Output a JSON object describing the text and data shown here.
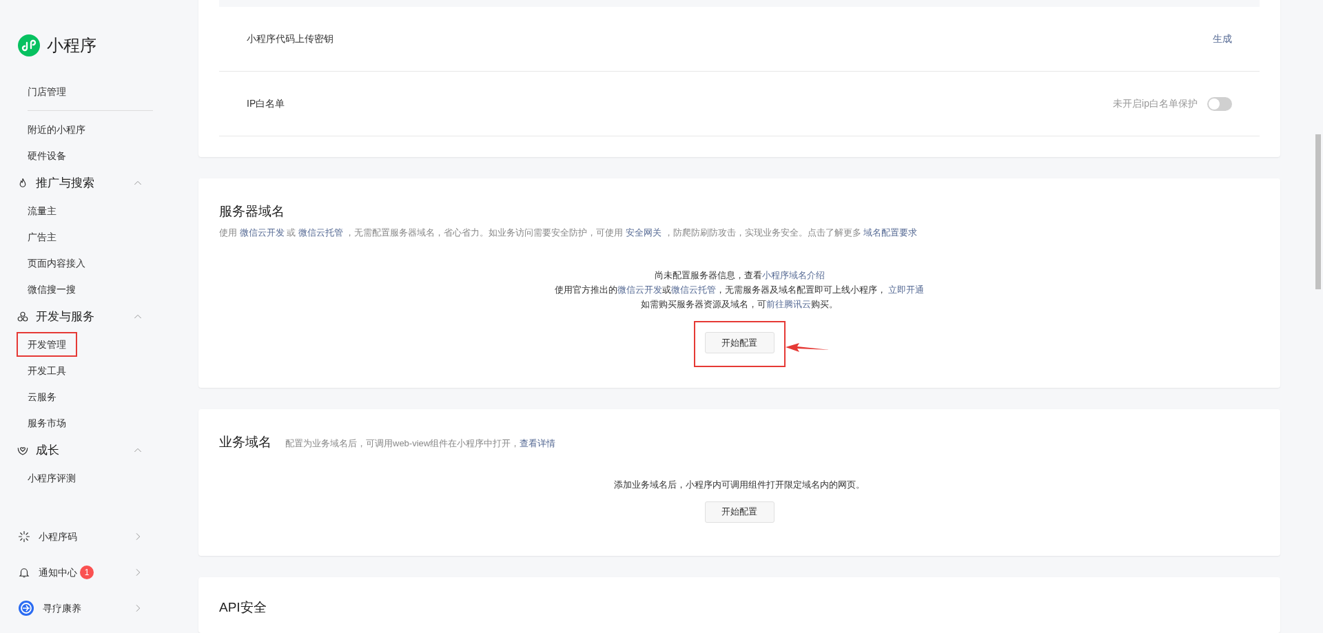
{
  "app": {
    "title": "小程序"
  },
  "sidebar": {
    "groups": [
      {
        "items": [
          {
            "label": "门店管理",
            "annotated": false
          }
        ]
      },
      {
        "items": [
          {
            "label": "附近的小程序",
            "annotated": false
          },
          {
            "label": "硬件设备",
            "annotated": false
          }
        ]
      },
      {
        "label": "推广与搜索",
        "expanded": true,
        "items": [
          {
            "label": "流量主",
            "annotated": false
          },
          {
            "label": "广告主",
            "annotated": false
          },
          {
            "label": "页面内容接入",
            "annotated": false
          },
          {
            "label": "微信搜一搜",
            "annotated": false
          }
        ]
      },
      {
        "label": "开发与服务",
        "expanded": true,
        "items": [
          {
            "label": "开发管理",
            "annotated": true
          },
          {
            "label": "开发工具",
            "annotated": false
          },
          {
            "label": "云服务",
            "annotated": false
          },
          {
            "label": "服务市场",
            "annotated": false
          }
        ]
      },
      {
        "label": "成长",
        "expanded": true,
        "items": [
          {
            "label": "小程序评测",
            "annotated": false
          }
        ]
      }
    ],
    "bottom": [
      {
        "label": "小程序码"
      },
      {
        "label": "通知中心",
        "badge": "1"
      },
      {
        "label": "寻疗康养"
      }
    ]
  },
  "settings_card": {
    "rows": [
      {
        "kind": "action",
        "label": "小程序代码上传密钥",
        "action": "生成"
      },
      {
        "kind": "toggle",
        "label": "IP白名单",
        "status": "未开启ip白名单保护",
        "on": false
      }
    ]
  },
  "server_domain": {
    "title": "服务器域名",
    "description": [
      {
        "kind": "text",
        "text": "使用 "
      },
      {
        "kind": "link",
        "text": "微信云开发"
      },
      {
        "kind": "text",
        "text": " 或 "
      },
      {
        "kind": "link",
        "text": "微信云托管"
      },
      {
        "kind": "text",
        "text": " ，无需配置服务器域名，省心省力。如业务访问需要安全防护，可使用 "
      },
      {
        "kind": "link",
        "text": "安全网关"
      },
      {
        "kind": "text",
        "text": " ，防爬防刷防攻击，实现业务安全。点击了解更多 "
      },
      {
        "kind": "link",
        "text": "域名配置要求"
      }
    ],
    "empty_lines": [
      [
        {
          "kind": "text",
          "text": "尚未配置服务器信息，查看"
        },
        {
          "kind": "link",
          "text": "小程序域名介绍"
        }
      ],
      [
        {
          "kind": "text",
          "text": "使用官方推出的"
        },
        {
          "kind": "link",
          "text": "微信云开发"
        },
        {
          "kind": "text",
          "text": "或"
        },
        {
          "kind": "link",
          "text": "微信云托管"
        },
        {
          "kind": "text",
          "text": "，无需服务器及域名配置即可上线小程序， "
        },
        {
          "kind": "link",
          "text": "立即开通"
        }
      ],
      [
        {
          "kind": "text",
          "text": "如需购买服务器资源及域名，可"
        },
        {
          "kind": "link",
          "text": "前往腾讯云"
        },
        {
          "kind": "text",
          "text": "购买。"
        }
      ]
    ],
    "button": "开始配置",
    "annotated": true
  },
  "business_domain": {
    "title": "业务域名",
    "hint": [
      {
        "kind": "text",
        "text": "配置为业务域名后，可调用web-view组件在小程序中打开，"
      },
      {
        "kind": "link",
        "text": "查看详情"
      }
    ],
    "empty_lines": [
      [
        {
          "kind": "text",
          "text": "添加业务域名后，小程序内可调用组件打开限定域名内的网页。"
        }
      ]
    ],
    "button": "开始配置",
    "annotated": false
  },
  "api_security": {
    "title": "API安全"
  }
}
